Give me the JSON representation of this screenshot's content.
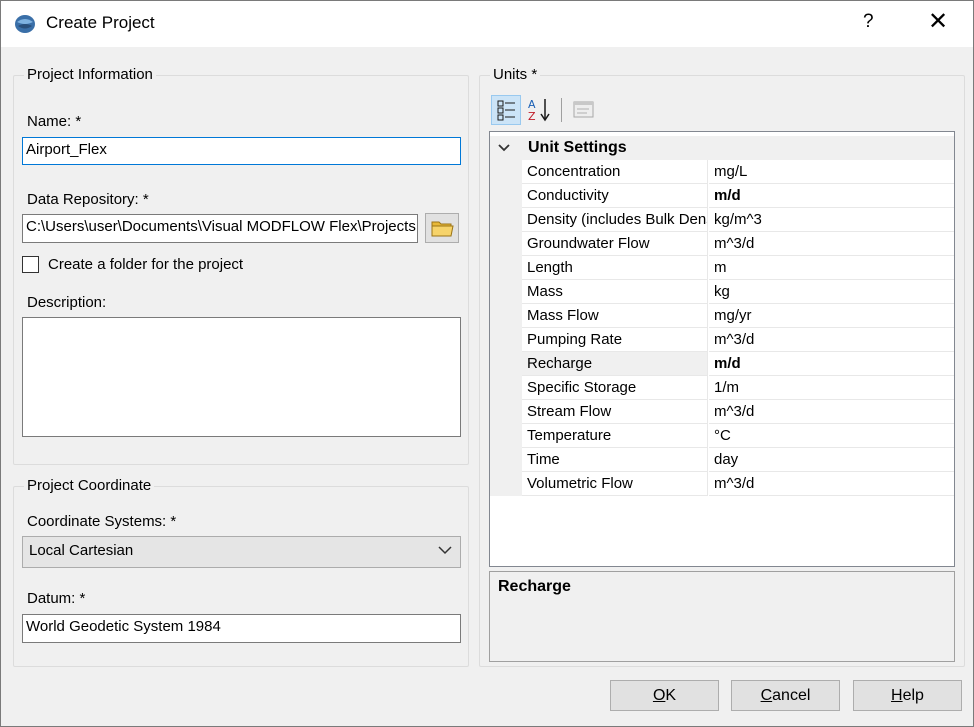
{
  "window": {
    "title": "Create Project",
    "help_label": "?",
    "close_label": "✕"
  },
  "project_info": {
    "group_title": "Project Information",
    "name_label": "Name: *",
    "name_value": "Airport_Flex",
    "repo_label": "Data Repository: *",
    "repo_value": "C:\\Users\\user\\Documents\\Visual MODFLOW Flex\\Projects",
    "create_folder_label": "Create a folder for the project",
    "create_folder_checked": false,
    "description_label": "Description:",
    "description_value": ""
  },
  "project_coordinate": {
    "group_title": "Project Coordinate",
    "coord_label": "Coordinate Systems: *",
    "coord_value": "Local Cartesian",
    "datum_label": "Datum: *",
    "datum_value": "World Geodetic System 1984"
  },
  "units": {
    "group_title": "Units *",
    "toolbar": {
      "categorized_icon": "categorized-view-icon",
      "alphabetical_icon": "sort-alphabetical-icon",
      "property_pages_icon": "property-pages-icon"
    },
    "category": "Unit Settings",
    "rows": [
      {
        "name": "Concentration",
        "value": "mg/L",
        "bold": false
      },
      {
        "name": "Conductivity",
        "value": "m/d",
        "bold": true
      },
      {
        "name": "Density (includes Bulk Density)",
        "value": "kg/m^3",
        "bold": false
      },
      {
        "name": "Groundwater Flow",
        "value": "m^3/d",
        "bold": false
      },
      {
        "name": "Length",
        "value": "m",
        "bold": false
      },
      {
        "name": "Mass",
        "value": "kg",
        "bold": false
      },
      {
        "name": "Mass Flow",
        "value": "mg/yr",
        "bold": false
      },
      {
        "name": "Pumping Rate",
        "value": "m^3/d",
        "bold": false
      },
      {
        "name": "Recharge",
        "value": "m/d",
        "bold": true
      },
      {
        "name": "Specific Storage",
        "value": "1/m",
        "bold": false
      },
      {
        "name": "Stream Flow",
        "value": "m^3/d",
        "bold": false
      },
      {
        "name": "Temperature",
        "value": "°C",
        "bold": false
      },
      {
        "name": "Time",
        "value": "day",
        "bold": false
      },
      {
        "name": "Volumetric Flow",
        "value": "m^3/d",
        "bold": false
      }
    ],
    "selected_row": "Recharge",
    "description_title": "Recharge"
  },
  "buttons": {
    "ok_mnemonic": "O",
    "ok_rest": "K",
    "cancel_mnemonic": "C",
    "cancel_rest": "ancel",
    "help_mnemonic": "H",
    "help_rest": "elp"
  },
  "colors": {
    "focus_border": "#0078d7",
    "dialog_bg": "#f0f0f0",
    "folder_icon": "#e8b838"
  }
}
